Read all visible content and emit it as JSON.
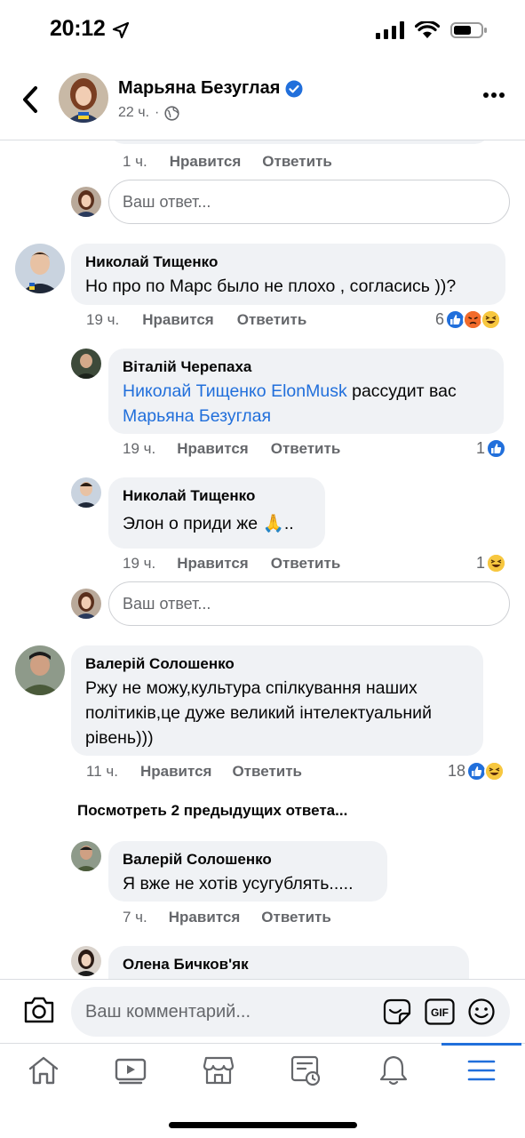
{
  "status_bar": {
    "time": "20:12"
  },
  "header": {
    "name": "Марьяна Безуглая",
    "meta_time": "22 ч.",
    "meta_sep": "·"
  },
  "top_partial": {
    "time": "1 ч.",
    "like": "Нравится",
    "reply": "Ответить"
  },
  "reply_placeholder": "Ваш ответ...",
  "comments": [
    {
      "author": "Николай Тищенко",
      "text": "Но про по Марс было не плохо , согласись ))?",
      "time": "19 ч.",
      "like": "Нравится",
      "reply": "Ответить",
      "reaction_count": "6"
    },
    {
      "author": "Віталій Черепаха",
      "mention1": "Николай Тищенко",
      "mention2": "ElonMusk",
      "text_mid": " рассудит вас",
      "mention3": "Марьяна Безуглая",
      "time": "19 ч.",
      "like": "Нравится",
      "reply": "Ответить",
      "reaction_count": "1"
    },
    {
      "author": "Николай Тищенко",
      "text": "Элон о приди же 🙏..",
      "time": "19 ч.",
      "like": "Нравится",
      "reply": "Ответить",
      "reaction_count": "1"
    },
    {
      "author": "Валерій Солошенко",
      "text": "Ржу не можу,культура спілкування наших політиків,це дуже великий інтелектуальний рівень)))",
      "time": "11 ч.",
      "like": "Нравится",
      "reply": "Ответить",
      "reaction_count": "18"
    },
    {
      "author": "Валерій Солошенко",
      "text": "Я вже не хотів усугублять.....",
      "time": "7 ч.",
      "like": "Нравится",
      "reply": "Ответить"
    },
    {
      "author": "Олена Бичков'як"
    }
  ],
  "view_previous": "Посмотреть 2 предыдущих ответа...",
  "composer": {
    "placeholder": "Ваш комментарий...",
    "gif_label": "GIF"
  },
  "colors": {
    "accent": "#216fdb",
    "bubble": "#f0f2f5",
    "muted": "#65676b"
  }
}
